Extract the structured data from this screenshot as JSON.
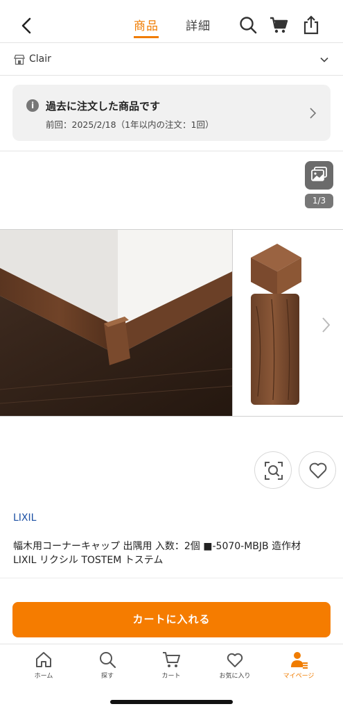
{
  "header": {
    "tabs": [
      {
        "label": "商品",
        "active": true
      },
      {
        "label": "詳細",
        "active": false
      }
    ],
    "accent_color": "#f07c00"
  },
  "store": {
    "name": "Clair"
  },
  "order_notice": {
    "title": "過去に注文した商品です",
    "subtitle": "前回：2025/2/18（1年以内の注文：1回）"
  },
  "gallery": {
    "counter": "1/3"
  },
  "product": {
    "brand": "LIXIL",
    "title_line1": "幅木用コーナーキャップ 出隅用 入数：2個 ■-5070-MBJB 造作材",
    "title_line2": "LIXIL リクシル TOSTEM トステム"
  },
  "actions": {
    "add_to_cart": "カートに入れる",
    "cart_button_color": "#f57c00"
  },
  "tabbar": {
    "items": [
      {
        "label": "ホーム",
        "icon": "home-icon"
      },
      {
        "label": "探す",
        "icon": "search-icon"
      },
      {
        "label": "カート",
        "icon": "cart-icon"
      },
      {
        "label": "お気に入り",
        "icon": "heart-icon"
      },
      {
        "label": "マイページ",
        "icon": "user-icon",
        "active": true
      }
    ]
  }
}
